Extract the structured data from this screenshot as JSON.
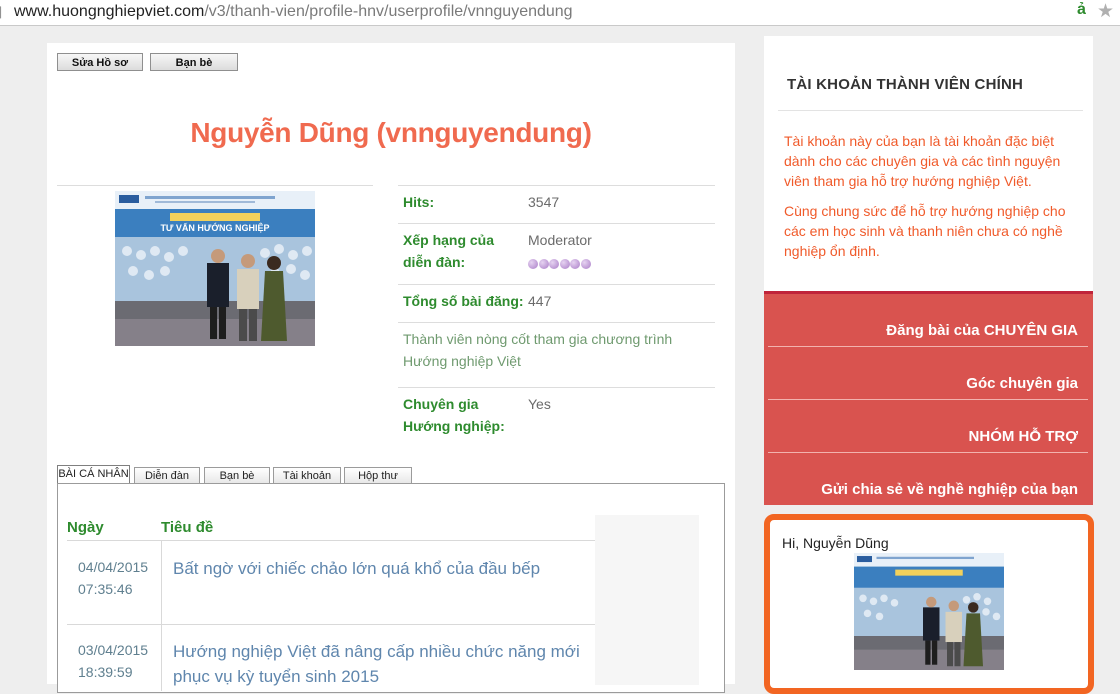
{
  "browser": {
    "url_host": "www.huongnghiepviet.com",
    "url_path": "/v3/thanh-vien/profile-hnv/userprofile/vnnguyendung"
  },
  "profile": {
    "buttons": {
      "edit": "Sửa Hồ sơ",
      "friends": "Bạn bè"
    },
    "title": "Nguyễn Dũng (vnnguyendung)",
    "photo_banner": "TƯ VẤN HƯỚNG NGHIỆP",
    "info": {
      "hits_label": "Hits:",
      "hits_value": "3547",
      "rank_label": "Xếp hạng của diễn đàn:",
      "rank_value": "Moderator",
      "rank_stars": 6,
      "posts_label": "Tổng số bài đăng:",
      "posts_value": "447",
      "description": "Thành viên nòng cốt tham gia chương trình Hướng nghiệp Việt",
      "expert_label": "Chuyên gia Hướng nghiệp:",
      "expert_value": "Yes"
    }
  },
  "tabs": [
    {
      "label": "BÀI CÁ NHÂN",
      "active": true
    },
    {
      "label": "Diễn đàn",
      "active": false
    },
    {
      "label": "Bạn bè",
      "active": false
    },
    {
      "label": "Tài khoản",
      "active": false
    },
    {
      "label": "Hộp thư",
      "active": false
    }
  ],
  "posts": {
    "col_date": "Ngày",
    "col_title": "Tiêu đề",
    "rows": [
      {
        "date": "04/04/2015",
        "time": "07:35:46",
        "title": "Bất ngờ với chiếc chảo lớn quá khổ của đầu bếp"
      },
      {
        "date": "03/04/2015",
        "time": "18:39:59",
        "title": "Hướng nghiệp Việt đã nâng cấp nhiều chức năng mới phục vụ kỳ tuyển sinh 2015"
      }
    ]
  },
  "sidebar": {
    "heading": "TÀI KHOẢN THÀNH VIÊN CHÍNH",
    "para1": "Tài khoản này của bạn là tài khoản đặc biệt dành cho các chuyên gia và các tình nguyện viên tham gia hỗ trợ hướng nghiệp Việt.",
    "para2": "Cùng chung sức để hỗ trợ hướng nghiệp cho các em học sinh và thanh niên chưa có nghề nghiệp ổn định.",
    "nav": [
      "Đăng bài của CHUYÊN GIA",
      "Góc chuyên gia",
      "NHÓM HỖ TRỢ",
      "Gửi chia sẻ về nghề nghiệp của bạn"
    ],
    "greeting": "Hi, Nguyễn Dũng"
  },
  "colors": {
    "title": "#f06a4f",
    "label_green": "#2e8b2e",
    "nav_red": "#d9534f",
    "accent_orange": "#f26522"
  }
}
